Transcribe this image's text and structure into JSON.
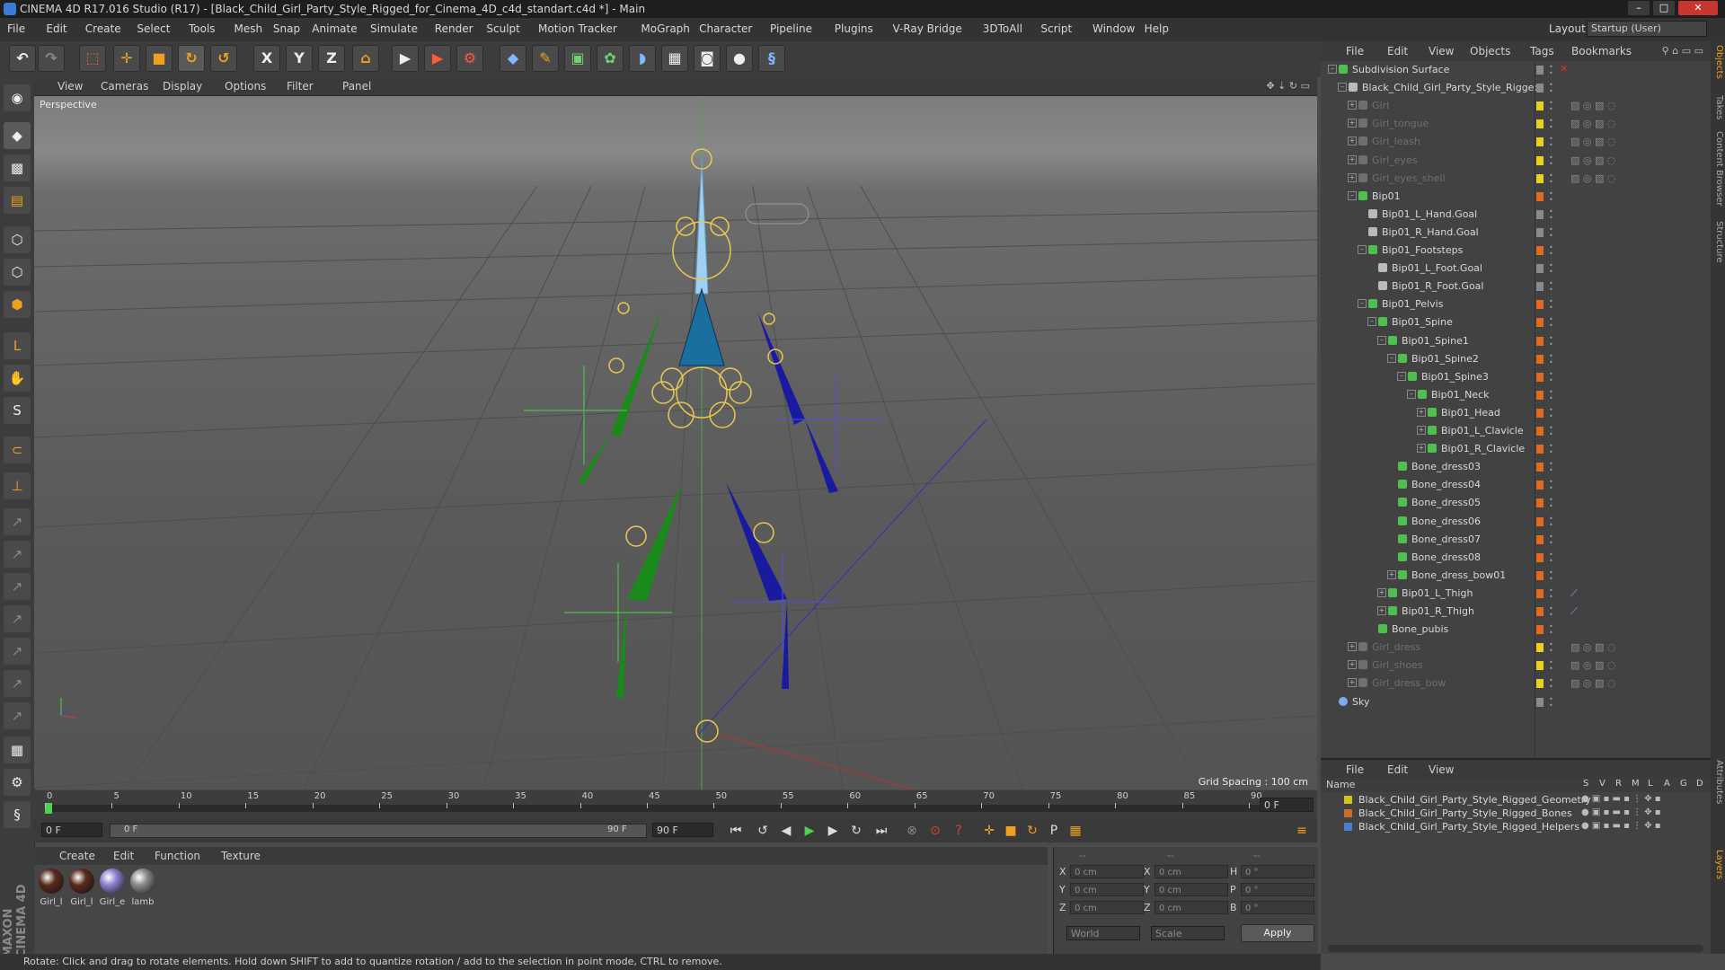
{
  "window": {
    "title": "CINEMA 4D R17.016 Studio (R17) - [Black_Child_Girl_Party_Style_Rigged_for_Cinema_4D_c4d_standart.c4d *] - Main"
  },
  "menubar": {
    "items": [
      "File",
      "Edit",
      "Create",
      "Select",
      "Tools",
      "Mesh",
      "Snap",
      "Animate",
      "Simulate",
      "Render",
      "Sculpt",
      "Motion Tracker",
      "MoGraph",
      "Character",
      "Pipeline",
      "Plugins",
      "V-Ray Bridge",
      "3DToAll",
      "Script",
      "Window",
      "Help"
    ],
    "layout_label": "Layout:",
    "layout_value": "Startup (User)"
  },
  "toolbar": {
    "axis_x": "X",
    "axis_y": "Y",
    "axis_z": "Z"
  },
  "viewport": {
    "menu": [
      "View",
      "Cameras",
      "Display",
      "Options",
      "Filter",
      "Panel"
    ],
    "camera_label": "Perspective",
    "grid_spacing": "Grid Spacing : 100 cm"
  },
  "timeline": {
    "ticks": [
      "0",
      "5",
      "10",
      "15",
      "20",
      "25",
      "30",
      "35",
      "40",
      "45",
      "50",
      "55",
      "60",
      "65",
      "70",
      "75",
      "80",
      "85",
      "90"
    ],
    "current_frame": "0 F",
    "start_frame": "0 F",
    "range_start": "0 F",
    "range_end": "90 F",
    "end_frame": "90 F"
  },
  "materials": {
    "menu": [
      "Create",
      "Edit",
      "Function",
      "Texture"
    ],
    "items": [
      {
        "label": "Girl_l",
        "color": "#5a2a1e"
      },
      {
        "label": "Girl_l",
        "color": "#5a2a1e"
      },
      {
        "label": "Girl_e",
        "color": "#8f7fd0"
      },
      {
        "label": "lamb",
        "color": "#8a8a8a"
      }
    ]
  },
  "coords": {
    "header": [
      "--",
      "--",
      "--"
    ],
    "rows": [
      {
        "a": "X",
        "av": "0 cm",
        "b": "X",
        "bv": "0 cm",
        "c": "H",
        "cv": "0 °"
      },
      {
        "a": "Y",
        "av": "0 cm",
        "b": "Y",
        "bv": "0 cm",
        "c": "P",
        "cv": "0 °"
      },
      {
        "a": "Z",
        "av": "0 cm",
        "b": "Z",
        "bv": "0 cm",
        "c": "B",
        "cv": "0 °"
      }
    ],
    "world": "World",
    "scale": "Scale",
    "apply": "Apply"
  },
  "status": {
    "text": "Rotate: Click and drag to rotate elements. Hold down SHIFT to add to quantize rotation / add to the selection in point mode, CTRL to remove."
  },
  "objects": {
    "menu": [
      "File",
      "Edit",
      "View",
      "Objects",
      "Tags",
      "Bookmarks"
    ],
    "rows": [
      {
        "name": "Subdivision Surface",
        "depth": 0,
        "exp": "-",
        "style": "normal",
        "tag": "grey",
        "icon": "#4fbf4f"
      },
      {
        "name": "Black_Child_Girl_Party_Style_Rigged",
        "depth": 1,
        "exp": "-",
        "style": "normal",
        "tag": "grey",
        "icon": "#bbbbbb"
      },
      {
        "name": "Girl",
        "depth": 2,
        "exp": "+",
        "style": "dim",
        "tag": "yellow",
        "icon": "#6f6f6f"
      },
      {
        "name": "Girl_tongue",
        "depth": 2,
        "exp": "+",
        "style": "dim",
        "tag": "yellow",
        "icon": "#6f6f6f"
      },
      {
        "name": "Girl_leash",
        "depth": 2,
        "exp": "+",
        "style": "dim",
        "tag": "yellow",
        "icon": "#6f6f6f"
      },
      {
        "name": "Girl_eyes",
        "depth": 2,
        "exp": "+",
        "style": "dim",
        "tag": "yellow",
        "icon": "#6f6f6f"
      },
      {
        "name": "Girl_eyes_shell",
        "depth": 2,
        "exp": "+",
        "style": "dim",
        "tag": "yellow",
        "icon": "#6f6f6f"
      },
      {
        "name": "Bip01",
        "depth": 2,
        "exp": "-",
        "style": "normal",
        "tag": "orange",
        "icon": "#4fbf4f"
      },
      {
        "name": "Bip01_L_Hand.Goal",
        "depth": 3,
        "exp": "",
        "style": "normal",
        "tag": "grey",
        "icon": "#bbbbbb"
      },
      {
        "name": "Bip01_R_Hand.Goal",
        "depth": 3,
        "exp": "",
        "style": "normal",
        "tag": "grey",
        "icon": "#bbbbbb"
      },
      {
        "name": "Bip01_Footsteps",
        "depth": 3,
        "exp": "-",
        "style": "normal",
        "tag": "orange",
        "icon": "#4fbf4f"
      },
      {
        "name": "Bip01_L_Foot.Goal",
        "depth": 4,
        "exp": "",
        "style": "normal",
        "tag": "grey",
        "icon": "#bbbbbb"
      },
      {
        "name": "Bip01_R_Foot.Goal",
        "depth": 4,
        "exp": "",
        "style": "normal",
        "tag": "grey",
        "icon": "#bbbbbb"
      },
      {
        "name": "Bip01_Pelvis",
        "depth": 3,
        "exp": "-",
        "style": "normal",
        "tag": "orange",
        "icon": "#4fbf4f"
      },
      {
        "name": "Bip01_Spine",
        "depth": 4,
        "exp": "-",
        "style": "normal",
        "tag": "orange",
        "icon": "#4fbf4f"
      },
      {
        "name": "Bip01_Spine1",
        "depth": 5,
        "exp": "-",
        "style": "normal",
        "tag": "orange",
        "icon": "#4fbf4f"
      },
      {
        "name": "Bip01_Spine2",
        "depth": 6,
        "exp": "-",
        "style": "normal",
        "tag": "orange",
        "icon": "#4fbf4f"
      },
      {
        "name": "Bip01_Spine3",
        "depth": 7,
        "exp": "-",
        "style": "normal",
        "tag": "orange",
        "icon": "#4fbf4f"
      },
      {
        "name": "Bip01_Neck",
        "depth": 8,
        "exp": "-",
        "style": "normal",
        "tag": "orange",
        "icon": "#4fbf4f"
      },
      {
        "name": "Bip01_Head",
        "depth": 9,
        "exp": "+",
        "style": "normal",
        "tag": "orange",
        "icon": "#4fbf4f"
      },
      {
        "name": "Bip01_L_Clavicle",
        "depth": 9,
        "exp": "+",
        "style": "normal",
        "tag": "orange",
        "icon": "#4fbf4f"
      },
      {
        "name": "Bip01_R_Clavicle",
        "depth": 9,
        "exp": "+",
        "style": "normal",
        "tag": "orange",
        "icon": "#4fbf4f"
      },
      {
        "name": "Bone_dress03",
        "depth": 6,
        "exp": "",
        "style": "normal",
        "tag": "orange",
        "icon": "#4fbf4f"
      },
      {
        "name": "Bone_dress04",
        "depth": 6,
        "exp": "",
        "style": "normal",
        "tag": "orange",
        "icon": "#4fbf4f"
      },
      {
        "name": "Bone_dress05",
        "depth": 6,
        "exp": "",
        "style": "normal",
        "tag": "orange",
        "icon": "#4fbf4f"
      },
      {
        "name": "Bone_dress06",
        "depth": 6,
        "exp": "",
        "style": "normal",
        "tag": "orange",
        "icon": "#4fbf4f"
      },
      {
        "name": "Bone_dress07",
        "depth": 6,
        "exp": "",
        "style": "normal",
        "tag": "orange",
        "icon": "#4fbf4f"
      },
      {
        "name": "Bone_dress08",
        "depth": 6,
        "exp": "",
        "style": "normal",
        "tag": "orange",
        "icon": "#4fbf4f"
      },
      {
        "name": "Bone_dress_bow01",
        "depth": 6,
        "exp": "+",
        "style": "normal",
        "tag": "orange",
        "icon": "#4fbf4f"
      },
      {
        "name": "Bip01_L_Thigh",
        "depth": 5,
        "exp": "+",
        "style": "normal",
        "tag": "orange",
        "icon": "#4fbf4f"
      },
      {
        "name": "Bip01_R_Thigh",
        "depth": 5,
        "exp": "+",
        "style": "normal",
        "tag": "orange",
        "icon": "#4fbf4f"
      },
      {
        "name": "Bone_pubis",
        "depth": 4,
        "exp": "",
        "style": "normal",
        "tag": "orange",
        "icon": "#4fbf4f"
      },
      {
        "name": "Girl_dress",
        "depth": 2,
        "exp": "+",
        "style": "dim",
        "tag": "yellow",
        "icon": "#6f6f6f"
      },
      {
        "name": "Girl_shoes",
        "depth": 2,
        "exp": "+",
        "style": "dim",
        "tag": "yellow",
        "icon": "#6f6f6f"
      },
      {
        "name": "Girl_dress_bow",
        "depth": 2,
        "exp": "+",
        "style": "dim",
        "tag": "yellow",
        "icon": "#6f6f6f"
      },
      {
        "name": "Sky",
        "depth": 0,
        "exp": "",
        "style": "normal",
        "tag": "grey",
        "icon": "#7faaee"
      }
    ]
  },
  "layers": {
    "menu": [
      "File",
      "Edit",
      "View"
    ],
    "header_name": "Name",
    "header_cols": [
      "S",
      "V",
      "R",
      "M",
      "L",
      "A",
      "G",
      "D"
    ],
    "rows": [
      {
        "name": "Black_Child_Girl_Party_Style_Rigged_Geometry",
        "color": "#d4c21c"
      },
      {
        "name": "Black_Child_Girl_Party_Style_Rigged_Bones",
        "color": "#d06a2a"
      },
      {
        "name": "Black_Child_Girl_Party_Style_Rigged_Helpers",
        "color": "#4a7fd0"
      }
    ]
  },
  "right_tabs": [
    "Objects",
    "Takes",
    "Content Browser",
    "Structure",
    "Attributes",
    "Layers"
  ],
  "brand": "MAXON CINEMA 4D"
}
